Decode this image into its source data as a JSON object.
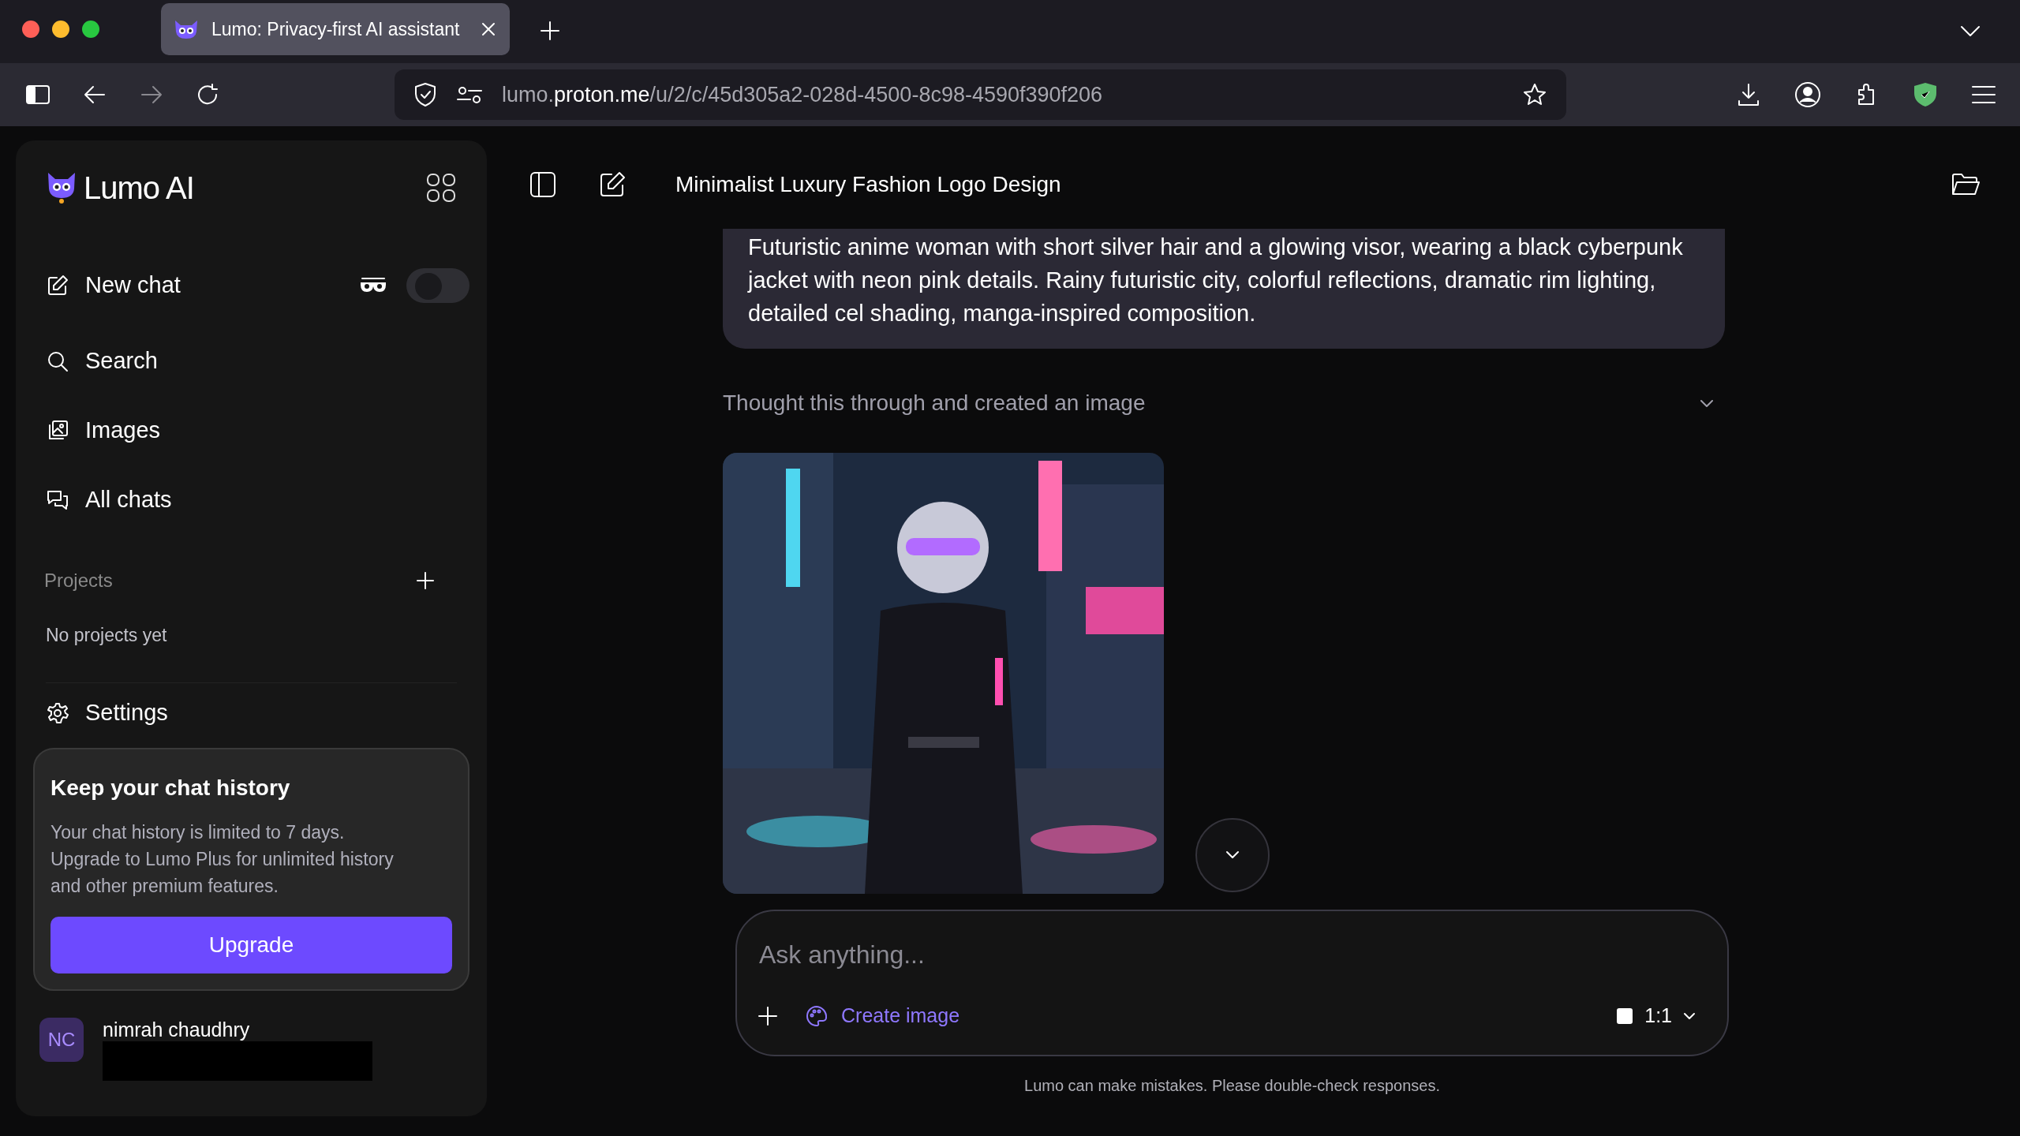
{
  "browser": {
    "tab": {
      "title": "Lumo: Privacy-first AI assistant",
      "selected": true
    },
    "url": {
      "prefix": "lumo.",
      "host": "proton.me",
      "path": "/u/2/c/45d305a2-028d-4500-8c98-4590f390f206"
    }
  },
  "sidebar": {
    "brand": "Lumo AI",
    "ghost_toggle": {
      "on": false
    },
    "items": [
      {
        "label": "New chat",
        "kind": "new"
      },
      {
        "label": "Search",
        "kind": "search"
      },
      {
        "label": "Images",
        "kind": "images"
      },
      {
        "label": "All chats",
        "kind": "chats"
      }
    ],
    "projects": {
      "heading": "Projects",
      "empty": "No projects yet"
    },
    "settings": "Settings",
    "upsell": {
      "title": "Keep your chat history",
      "body": "Your chat history is limited to 7 days. Upgrade to Lumo Plus for unlimited history and other premium features.",
      "button": "Upgrade"
    },
    "user": {
      "initials": "NC",
      "name": "nimrah chaudhry"
    }
  },
  "chat": {
    "title": "Minimalist Luxury Fashion Logo Design",
    "prompt": "Futuristic anime woman with short silver hair and a glowing visor, wearing a black cyberpunk jacket with neon pink details. Rainy futuristic city, colorful reflections, dramatic rim lighting, detailed cel shading, manga-inspired composition.",
    "thought": "Thought this through and created an image",
    "thought_expanded": false
  },
  "composer": {
    "placeholder": "Ask anything...",
    "create_image": "Create image",
    "aspect": "1:1"
  },
  "disclaimer": "Lumo can make mistakes. Please double-check responses."
}
